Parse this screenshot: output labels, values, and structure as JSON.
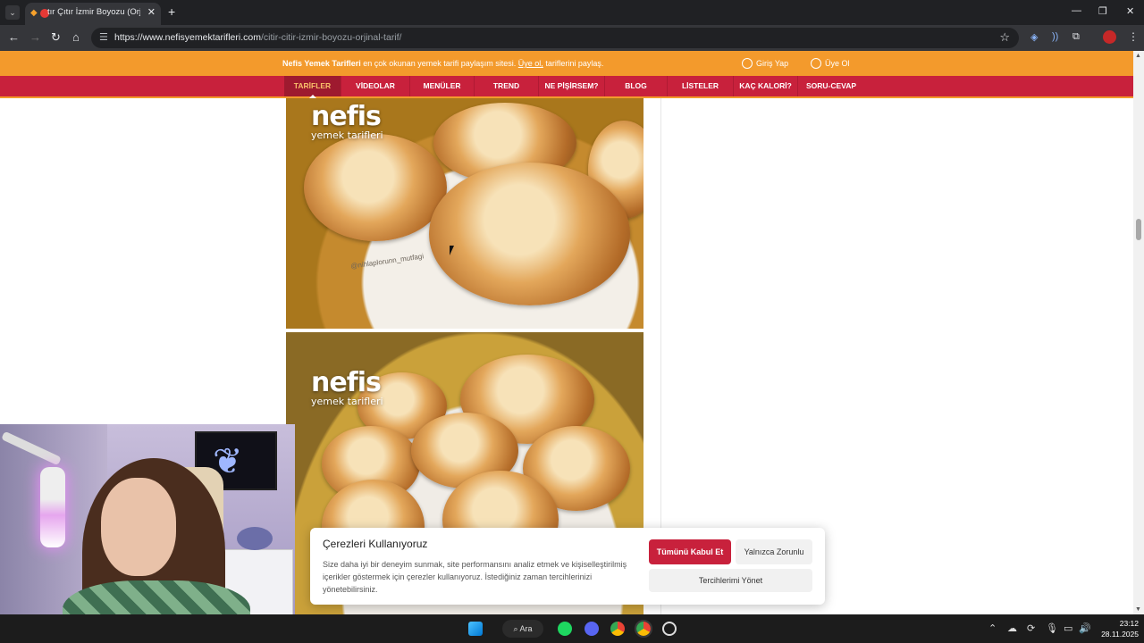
{
  "browser": {
    "tab_title": "tır Çıtır İzmir Boyozu (Orjinal Tarif)",
    "url_host": "https://www.nefisyemektarifleri.com",
    "url_path": "/citir-citir-izmir-boyozu-orjinal-tarif/",
    "new_tab": "+",
    "close_tab": "✕"
  },
  "site": {
    "promo_brand": "Nefis Yemek Tarifleri",
    "promo_text": " en çok okunan yemek tarifi paylaşım sitesi. ",
    "promo_link": "Üye ol,",
    "promo_end": " tariflerini paylaş.",
    "login": "Giriş Yap",
    "signup": "Üye Ol"
  },
  "nav": {
    "items": [
      "TARİFLER",
      "VİDEOLAR",
      "MENÜLER",
      "TREND",
      "NE PİŞİRSEM?",
      "BLOG",
      "LİSTELER",
      "KAÇ KALORİ?",
      "SORU-CEVAP"
    ]
  },
  "photos": {
    "logo_big": "nefis",
    "logo_small": "yemek tarifleri",
    "watermark": "@nihlaplorunn_mutfagi"
  },
  "cookie": {
    "title": "Çerezleri Kullanıyoruz",
    "text": "Size daha iyi bir deneyim sunmak, site performansını analiz etmek ve kişiselleştirilmiş içerikler göstermek için çerezler kullanıyoruz. İstediğiniz zaman tercihlerinizi yönetebilirsiniz.",
    "accept": "Tümünü Kabul Et",
    "necessary": "Yalnızca Zorunlu",
    "preferences": "Tercihlerimi Yönet"
  },
  "taskbar": {
    "search": "Ara",
    "time": "23:12",
    "date": "28.11.2025"
  },
  "colors": {
    "orange": "#f39a2c",
    "red": "#c8213c"
  }
}
